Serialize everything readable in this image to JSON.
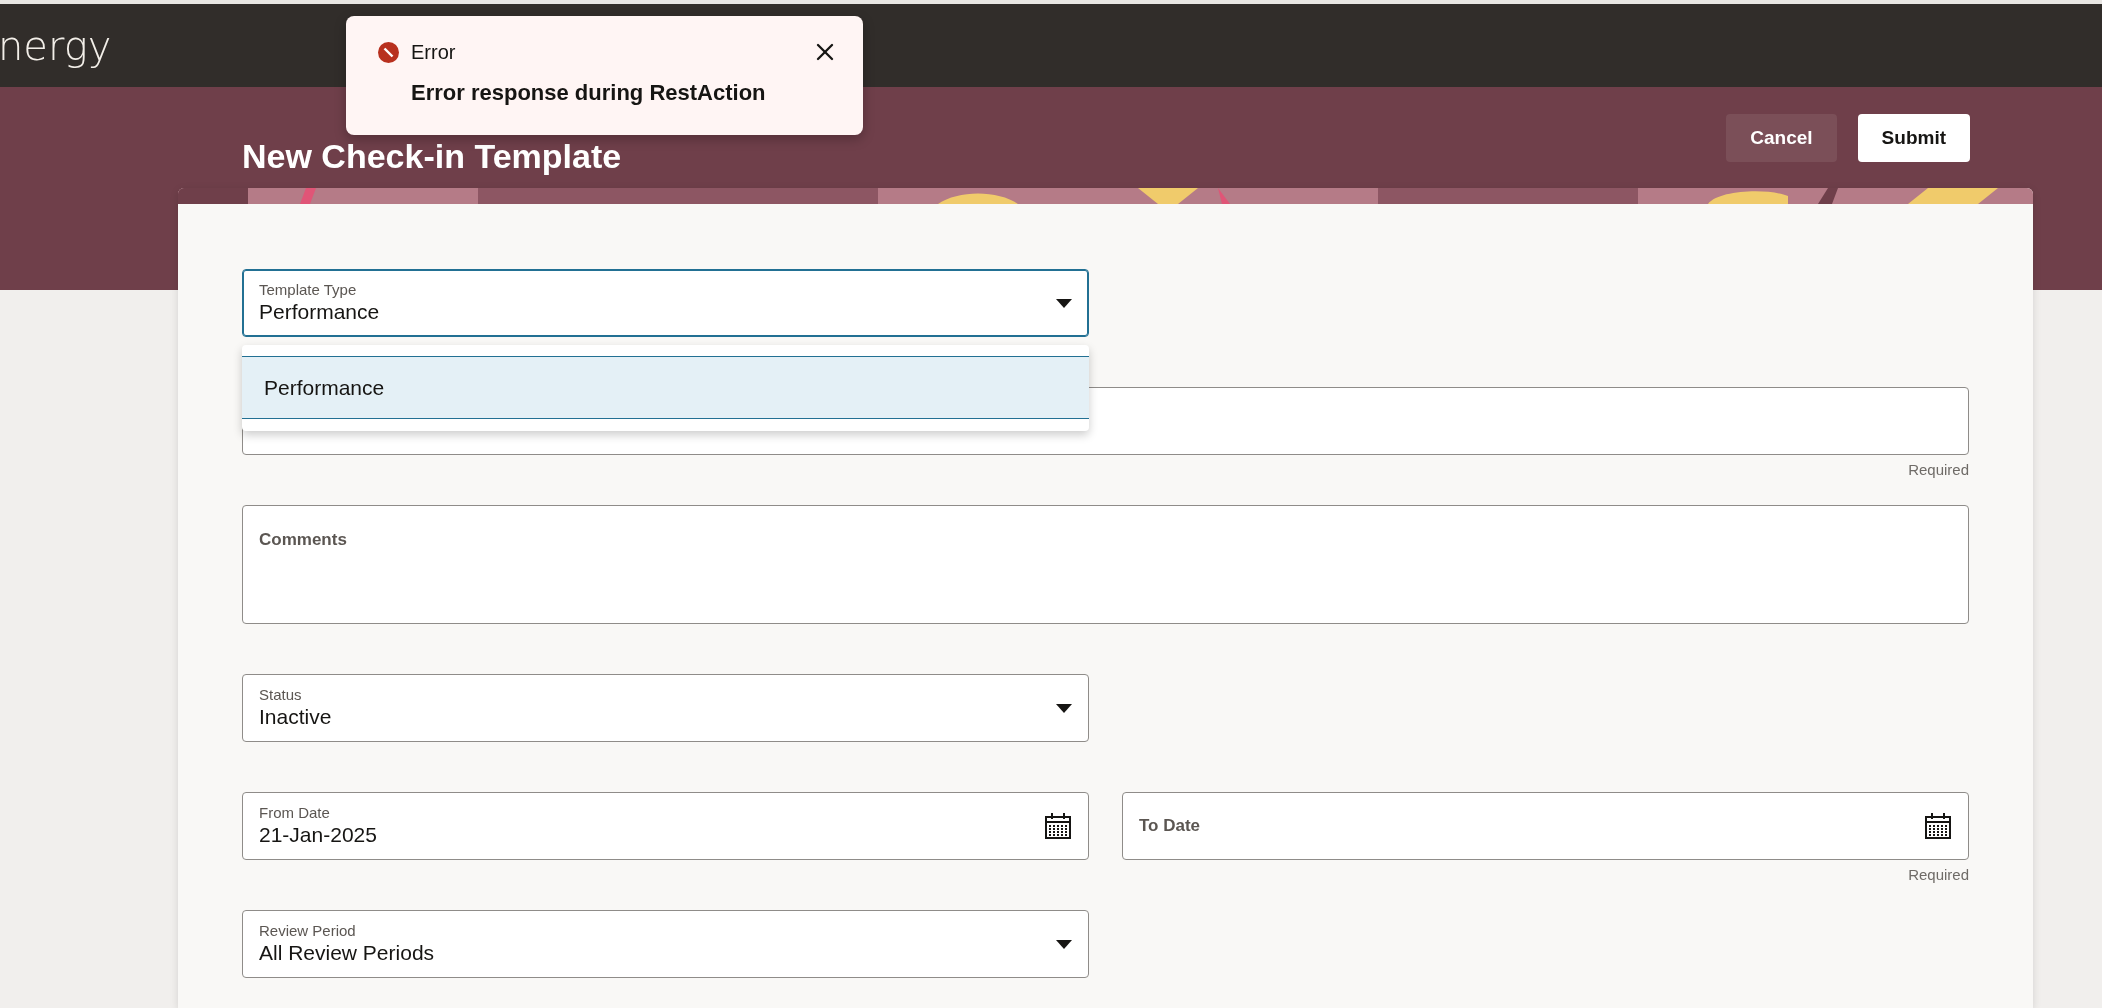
{
  "header": {
    "logo": "nergy"
  },
  "toast": {
    "title": "Error",
    "message": "Error response during RestAction"
  },
  "page": {
    "title": "New Check-in Template"
  },
  "actions": [
    {
      "label": "Cancel",
      "kind": "secondary"
    },
    {
      "label": "Submit",
      "kind": "primary"
    }
  ],
  "form": {
    "fields": [
      {
        "kind": "select",
        "label": "Template Type",
        "value": "Performance",
        "open": true,
        "options": [
          {
            "label": "Performance",
            "selected": true
          }
        ]
      },
      {
        "kind": "text",
        "helper": "Required"
      },
      {
        "kind": "textarea",
        "label": "Comments"
      },
      {
        "kind": "select",
        "label": "Status",
        "value": "Inactive",
        "open": false
      },
      {
        "kind": "date",
        "label": "From Date",
        "value": "21-Jan-2025"
      },
      {
        "kind": "date",
        "label": "To Date",
        "helper": "Required"
      },
      {
        "kind": "select",
        "label": "Review Period",
        "value": "All Review Periods",
        "open": false
      }
    ]
  }
}
